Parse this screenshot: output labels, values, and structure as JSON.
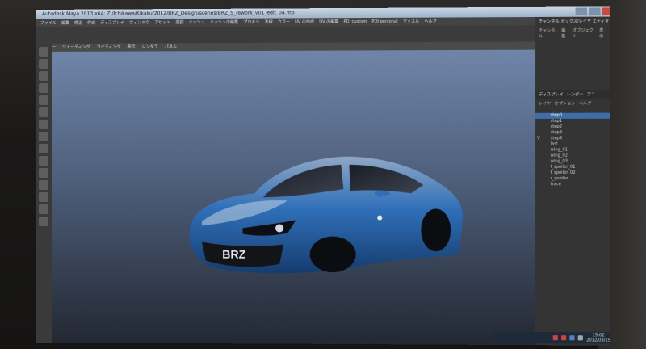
{
  "window": {
    "title": "Autodesk Maya 2013 x64: Z:/Ichikawa/Kikaku/2012/BRZ_Design/scenes/BRZ_S_rework_v01_edit_04.mb",
    "controls": [
      "minimize",
      "maximize",
      "close"
    ]
  },
  "menu": {
    "items": [
      "ファイル",
      "編集",
      "修正",
      "作成",
      "ディスプレイ",
      "ウィンドウ",
      "アセット",
      "選択",
      "メッシュ",
      "メッシュの編集",
      "プロキシ",
      "法線",
      "カラー",
      "UV の作成",
      "UV の編集",
      "PDI custom",
      "PDI personal",
      "マッスル",
      "ヘルプ"
    ]
  },
  "shelf": {
    "items": [
      "ビュー",
      "シェーディング",
      "ライティング",
      "表示",
      "レンダラ",
      "パネル"
    ]
  },
  "viewport": {
    "subject": "car-model",
    "badge_text": "BRZ",
    "colors": {
      "sky_top": "#6f85a8",
      "sky_bottom": "#232833",
      "car_body": "#2f6fb8"
    }
  },
  "right_panel": {
    "header_labels": [
      "チャンネル ボックス/レイヤ エディタ",
      "チャンネル",
      "編集",
      "オブジェクト",
      "表示"
    ],
    "tabs": [
      "ディスプレイ",
      "レンダー",
      "アニ"
    ],
    "menu": [
      "レイヤ",
      "オプション",
      "ヘルプ"
    ],
    "layers": [
      {
        "name": "step0",
        "visible": "",
        "selected": true
      },
      {
        "name": "step1",
        "visible": "",
        "selected": false
      },
      {
        "name": "step2",
        "visible": "",
        "selected": false
      },
      {
        "name": "step3",
        "visible": "",
        "selected": false
      },
      {
        "name": "step4",
        "visible": "V",
        "selected": false
      },
      {
        "name": "last",
        "visible": "",
        "selected": false
      },
      {
        "name": "wing_01",
        "visible": "",
        "selected": false
      },
      {
        "name": "wing_02",
        "visible": "",
        "selected": false
      },
      {
        "name": "wing_03",
        "visible": "",
        "selected": false
      },
      {
        "name": "f_spoiler_01",
        "visible": "",
        "selected": false
      },
      {
        "name": "f_spoiler_02",
        "visible": "",
        "selected": false
      },
      {
        "name": "r_spoiler",
        "visible": "",
        "selected": false
      },
      {
        "name": "trace",
        "visible": "",
        "selected": false
      }
    ]
  },
  "taskbar": {
    "time": "15:02",
    "date": "2012/03/15"
  }
}
